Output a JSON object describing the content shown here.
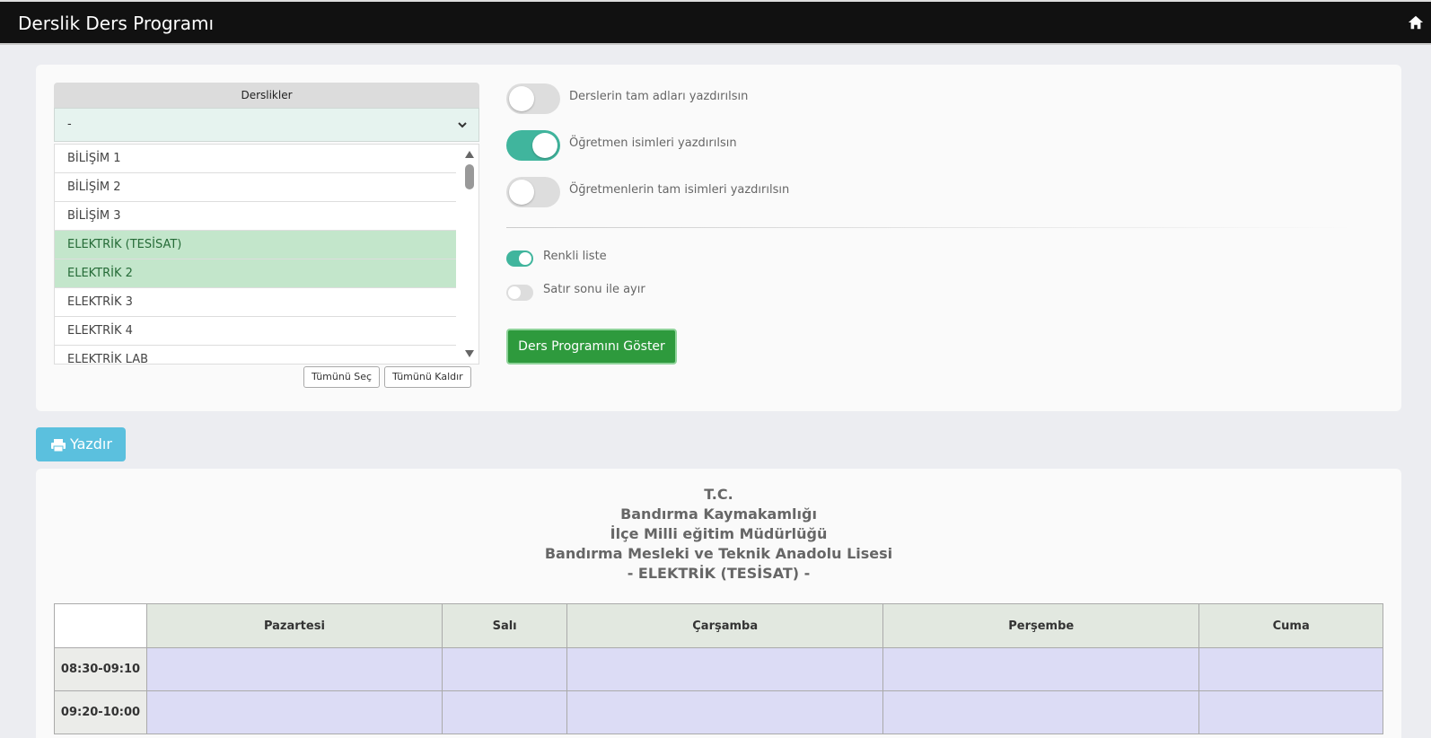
{
  "header": {
    "title": "Derslik Ders Programı",
    "home_icon": "home-icon"
  },
  "classroom_list": {
    "heading": "Derslikler",
    "dropdown_value": "-",
    "items": [
      {
        "label": "BİLİŞİM 1",
        "selected": false
      },
      {
        "label": "BİLİŞİM 2",
        "selected": false
      },
      {
        "label": "BİLİŞİM 3",
        "selected": false
      },
      {
        "label": "ELEKTRİK (TESİSAT)",
        "selected": true
      },
      {
        "label": "ELEKTRİK 2",
        "selected": true
      },
      {
        "label": "ELEKTRİK 3",
        "selected": false
      },
      {
        "label": "ELEKTRİK 4",
        "selected": false
      },
      {
        "label": "ELEKTRİK LAB",
        "selected": false
      }
    ],
    "select_all_label": "Tümünü Seç",
    "clear_all_label": "Tümünü Kaldır"
  },
  "options": {
    "full_course_names": {
      "label": "Derslerin tam adları yazdırılsın",
      "on": false
    },
    "teacher_names": {
      "label": "Öğretmen isimleri yazdırılsın",
      "on": true
    },
    "teacher_full_names": {
      "label": "Öğretmenlerin tam isimleri yazdırılsın",
      "on": false
    },
    "colored_list": {
      "label": "Renkli liste",
      "on": true
    },
    "line_break": {
      "label": "Satır sonu ile ayır",
      "on": false
    },
    "show_button_label": "Ders Programını Göster"
  },
  "print_button_label": "Yazdır",
  "schedule": {
    "heading_lines": [
      "T.C.",
      "Bandırma Kaymakamlığı",
      "İlçe Milli eğitim Müdürlüğü",
      "Bandırma Mesleki ve Teknik Anadolu Lisesi",
      "- ELEKTRİK (TESİSAT) -"
    ],
    "days": [
      "Pazartesi",
      "Salı",
      "Çarşamba",
      "Perşembe",
      "Cuma"
    ],
    "time_slots": [
      "08:30-09:10",
      "09:20-10:00"
    ]
  },
  "colors": {
    "accent_green": "#2e9a3d",
    "toggle_on": "#40b59d",
    "print_blue": "#5bc0de",
    "selected_row": "#c3e6cb"
  }
}
